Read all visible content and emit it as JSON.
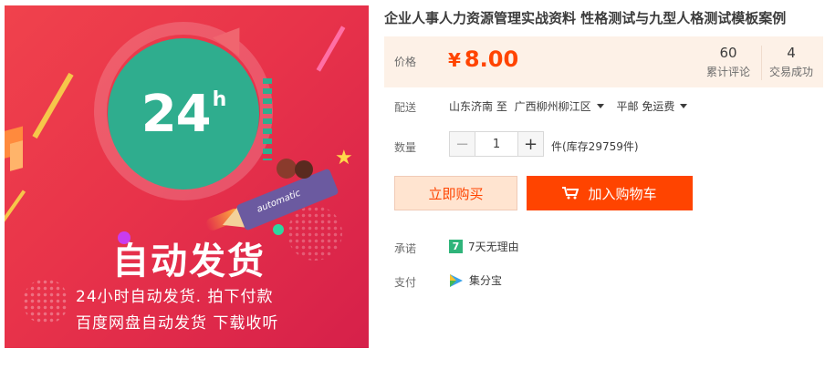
{
  "image": {
    "badge_number": "24",
    "badge_unit": "h",
    "headline": "自动发货",
    "subline1": "24小时自动发货. 拍下付款",
    "subline2": "百度网盘自动发货  下载收听",
    "pencil_text": "automatic",
    "colors": {
      "background": "#e8334a",
      "circle": "#2fad8e",
      "accent_yellow": "#f6c64a"
    }
  },
  "product": {
    "title": "企业人事人力资源管理实战资料 性格测试与九型人格测试模板案例"
  },
  "price": {
    "label": "价格",
    "currency": "¥",
    "value": "8.00",
    "color": "#ff4400"
  },
  "stats": {
    "reviews_count": "60",
    "reviews_label": "累计评论",
    "deals_count": "4",
    "deals_label": "交易成功"
  },
  "shipping": {
    "label": "配送",
    "from": "山东济南 至",
    "to": "广西柳州柳江区",
    "method": "平邮 免运费"
  },
  "quantity": {
    "label": "数量",
    "value": "1",
    "minus": "−",
    "plus": "+",
    "stock_text": "件(库存29759件)"
  },
  "actions": {
    "buy_now": "立即购买",
    "add_to_cart": "加入购物车",
    "primary_color": "#ff4400"
  },
  "promise": {
    "label": "承诺",
    "badge": "7",
    "text": "7天无理由"
  },
  "payment": {
    "label": "支付",
    "icon": "jifenbao-icon",
    "text": "集分宝"
  }
}
